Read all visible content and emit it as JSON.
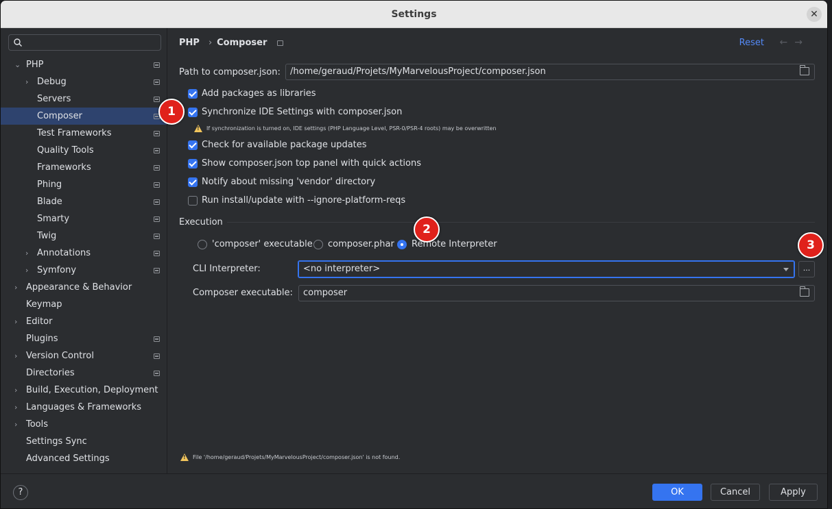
{
  "window": {
    "title": "Settings",
    "close_glyph": "✕"
  },
  "sidebar": {
    "search_placeholder": "",
    "items": [
      {
        "label": "PHP",
        "expanded": true,
        "pinned": true
      },
      {
        "label": "Debug",
        "expandable": true,
        "pinned": true
      },
      {
        "label": "Servers",
        "pinned": true
      },
      {
        "label": "Composer",
        "selected": true,
        "pinned": true
      },
      {
        "label": "Test Frameworks",
        "pinned": true
      },
      {
        "label": "Quality Tools",
        "pinned": true
      },
      {
        "label": "Frameworks",
        "pinned": true
      },
      {
        "label": "Phing",
        "pinned": true
      },
      {
        "label": "Blade",
        "pinned": true
      },
      {
        "label": "Smarty",
        "pinned": true
      },
      {
        "label": "Twig",
        "pinned": true
      },
      {
        "label": "Annotations",
        "expandable": true,
        "pinned": true
      },
      {
        "label": "Symfony",
        "expandable": true,
        "pinned": true
      },
      {
        "label": "Appearance & Behavior",
        "expandable": true
      },
      {
        "label": "Keymap"
      },
      {
        "label": "Editor",
        "expandable": true
      },
      {
        "label": "Plugins",
        "pinned": true
      },
      {
        "label": "Version Control",
        "expandable": true,
        "pinned": true
      },
      {
        "label": "Directories",
        "pinned": true
      },
      {
        "label": "Build, Execution, Deployment",
        "expandable": true
      },
      {
        "label": "Languages & Frameworks",
        "expandable": true
      },
      {
        "label": "Tools",
        "expandable": true
      },
      {
        "label": "Settings Sync"
      },
      {
        "label": "Advanced Settings"
      }
    ]
  },
  "header": {
    "breadcrumb": [
      "PHP",
      "Composer"
    ],
    "breadcrumb_sep": "›",
    "reset_label": "Reset",
    "back_glyph": "←",
    "forward_glyph": "→"
  },
  "path": {
    "label": "Path to composer.json:",
    "value": "/home/geraud/Projets/MyMarvelousProject/composer.json"
  },
  "options": [
    {
      "label": "Add packages as libraries",
      "checked": true
    },
    {
      "label": "Synchronize IDE Settings with composer.json",
      "checked": true
    },
    {
      "label": "Check for available package updates",
      "checked": true
    },
    {
      "label": "Show composer.json top panel with quick actions",
      "checked": true
    },
    {
      "label": "Notify about missing 'vendor' directory",
      "checked": true
    },
    {
      "label": "Run install/update with --ignore-platform-reqs",
      "checked": false
    }
  ],
  "sync_warning": "If synchronization is turned on, IDE settings (PHP Language Level, PSR-0/PSR-4 roots) may be overwritten",
  "execution": {
    "title": "Execution",
    "radios": [
      {
        "label": "'composer' executable",
        "selected": false
      },
      {
        "label": "composer.phar",
        "selected": false
      },
      {
        "label": "Remote Interpreter",
        "selected": true
      }
    ],
    "cli_label": "CLI Interpreter:",
    "cli_value": "<no interpreter>",
    "dots_label": "...",
    "composer_exec_label": "Composer executable:",
    "composer_exec_value": "composer"
  },
  "bottom_warning": "File '/home/geraud/Projets/MyMarvelousProject/composer.json' is not found.",
  "badges": [
    "1",
    "2",
    "3"
  ],
  "footer": {
    "help": "?",
    "ok": "OK",
    "cancel": "Cancel",
    "apply": "Apply"
  },
  "colors": {
    "accent": "#3574f0",
    "link": "#548af7",
    "badge": "#e0211b",
    "warning": "#f2c55c",
    "selection": "#2e436e"
  }
}
